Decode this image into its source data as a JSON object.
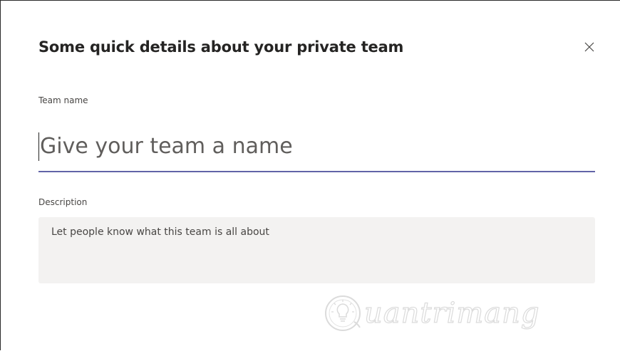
{
  "dialog": {
    "title": "Some quick details about your private team",
    "close_icon": "close-icon"
  },
  "team_name": {
    "label": "Team name",
    "placeholder": "Give your team a name",
    "value": ""
  },
  "description": {
    "label": "Description",
    "placeholder": "Let people know what this team is all about",
    "value": ""
  },
  "watermark": {
    "text": "uantrimang",
    "icon": "lightbulb-logo-icon"
  },
  "colors": {
    "accent": "#6264a7",
    "title_text": "#252423",
    "input_background": "#f3f2f1"
  }
}
